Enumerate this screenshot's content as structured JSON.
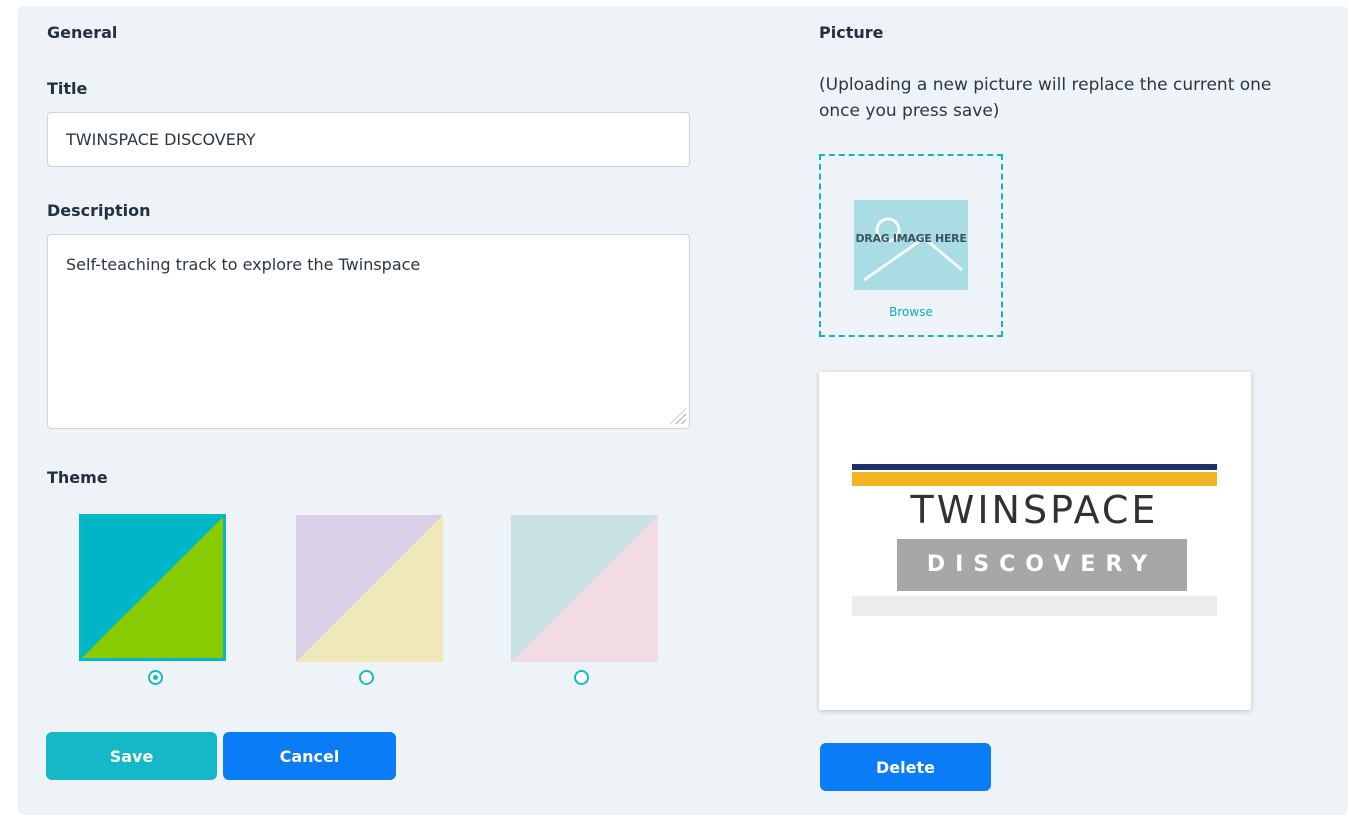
{
  "general": {
    "heading": "General",
    "title_label": "Title",
    "title_value": "TWINSPACE DISCOVERY",
    "description_label": "Description",
    "description_value": "Self-teaching track to explore the Twinspace",
    "theme_label": "Theme",
    "themes": [
      {
        "colors": [
          "#00b6c6",
          "#88cc00"
        ],
        "selected": true
      },
      {
        "colors": [
          "#d9d0e8",
          "#f0e8b8"
        ],
        "selected": false
      },
      {
        "colors": [
          "#c9e1e4",
          "#f1dbe5"
        ],
        "selected": false
      }
    ],
    "save_label": "Save",
    "cancel_label": "Cancel"
  },
  "picture": {
    "heading": "Picture",
    "hint": "(Uploading a new picture will replace the current one once you press save)",
    "drop_text": "DRAG IMAGE HERE",
    "browse_label": "Browse",
    "logo_title": "TWINSPACE",
    "logo_subtitle": "DISCOVERY",
    "delete_label": "Delete"
  },
  "colors": {
    "panel_bg": "#edf3f7",
    "save_bg": "#14b8c7",
    "primary_bg": "#0a7cf5",
    "accent": "#14b8c7"
  }
}
